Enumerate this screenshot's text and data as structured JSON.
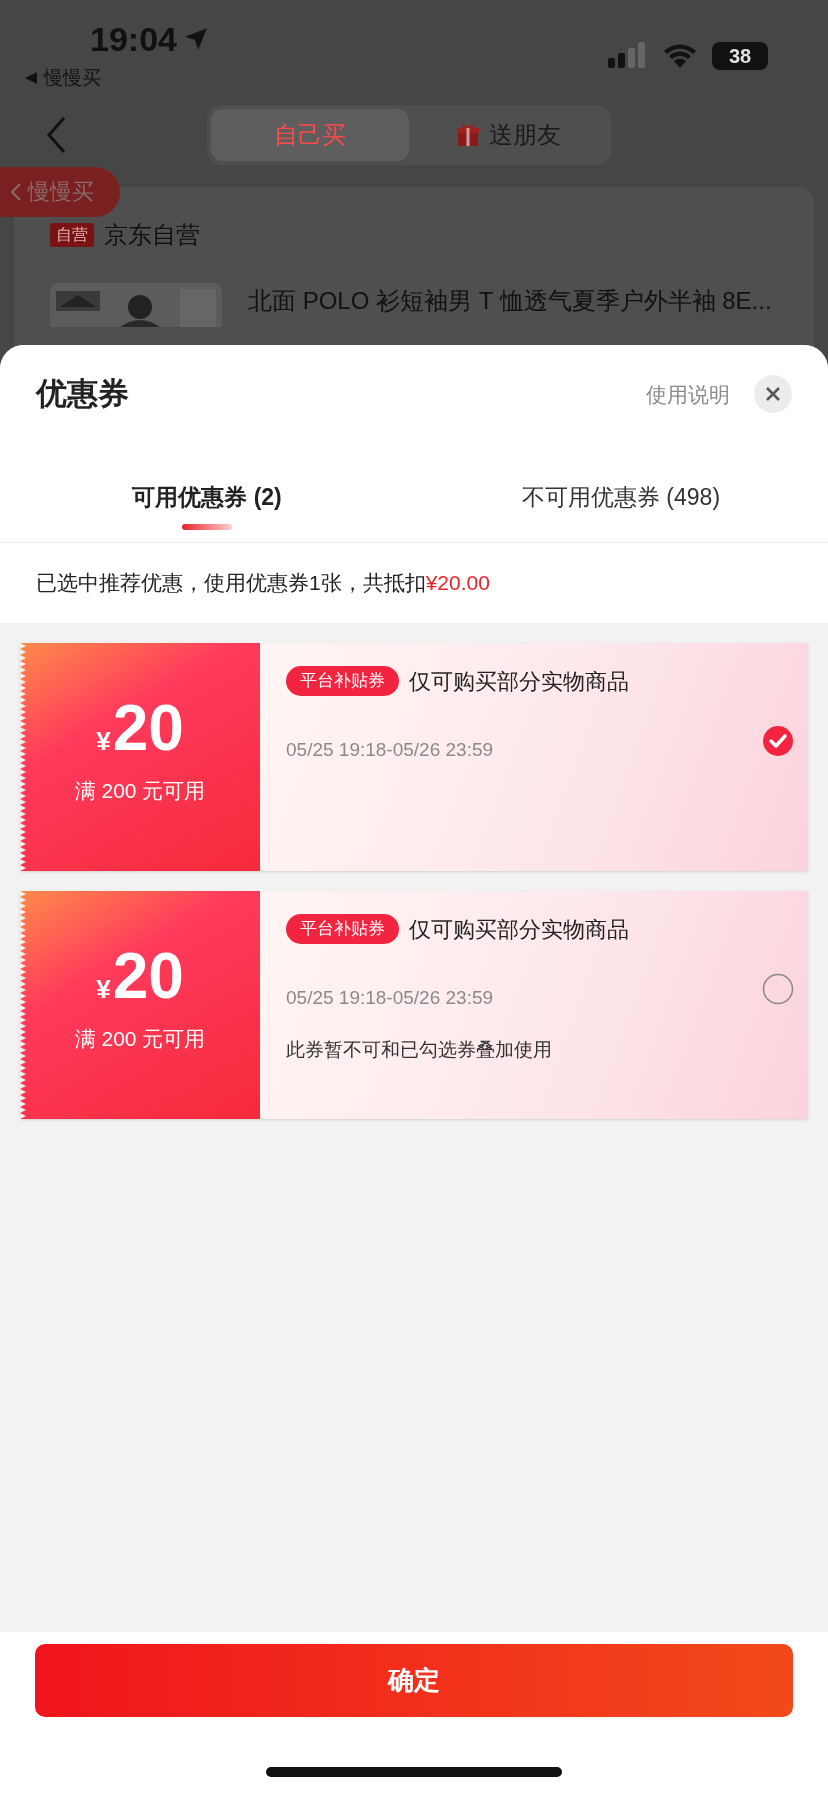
{
  "status_bar": {
    "time": "19:04",
    "back_app": "慢慢买",
    "battery": "38"
  },
  "nav": {
    "tabs": [
      {
        "label": "自己买",
        "selected": true,
        "kind": "plain"
      },
      {
        "label": "送朋友",
        "selected": false,
        "kind": "gift"
      }
    ]
  },
  "float_back": "慢慢买",
  "shop": {
    "badge": "自营",
    "name": "京东自营"
  },
  "product": {
    "title": "北面 POLO 衫短袖男 T 恤透气夏季户外半袖 8E..."
  },
  "sheet": {
    "title": "优惠券",
    "help": "使用说明",
    "tabs": [
      {
        "label": "可用优惠券 (2)",
        "selected": true
      },
      {
        "label": "不可用优惠券 (498)",
        "selected": false
      }
    ],
    "summary": "已选中推荐优惠，使用优惠券1张，共抵扣",
    "summary_amount": "¥20.00",
    "coupons": [
      {
        "currency": "¥",
        "amount": "20",
        "condition": "满 200 元可用",
        "tag": "平台补贴券",
        "scope": "仅可购买部分实物商品",
        "validity": "05/25 19:18-05/26 23:59",
        "selected": true
      },
      {
        "currency": "¥",
        "amount": "20",
        "condition": "满 200 元可用",
        "tag": "平台补贴券",
        "scope": "仅可购买部分实物商品",
        "validity": "05/25 19:18-05/26 23:59",
        "note": "此券暂不可和已勾选券叠加使用",
        "selected": false
      }
    ]
  },
  "confirm": "确定"
}
